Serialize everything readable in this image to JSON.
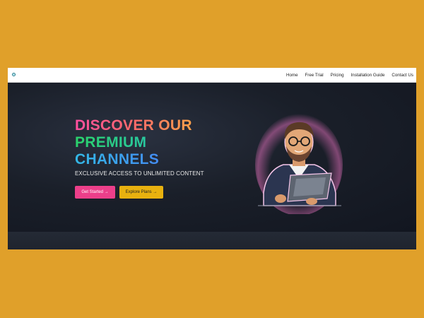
{
  "nav": {
    "links": [
      "Home",
      "Free Trial",
      "Pricing",
      "Installation Guide",
      "Contact Us"
    ]
  },
  "hero": {
    "title_line1": "DISCOVER OUR",
    "title_line2": "PREMIUM",
    "title_line3": "CHANNELS",
    "subtitle": "EXCLUSIVE ACCESS TO UNLIMITED CONTENT",
    "primary_button": "Get Started →",
    "secondary_button": "Explore Plans →"
  },
  "colors": {
    "page_background": "#e0a02a",
    "hero_background": "#161a23",
    "primary_button": "#ec3f8a",
    "secondary_button": "#e8b10f"
  },
  "icons": {
    "logo": "logo-icon",
    "illustration": "man-with-laptop-illustration"
  }
}
